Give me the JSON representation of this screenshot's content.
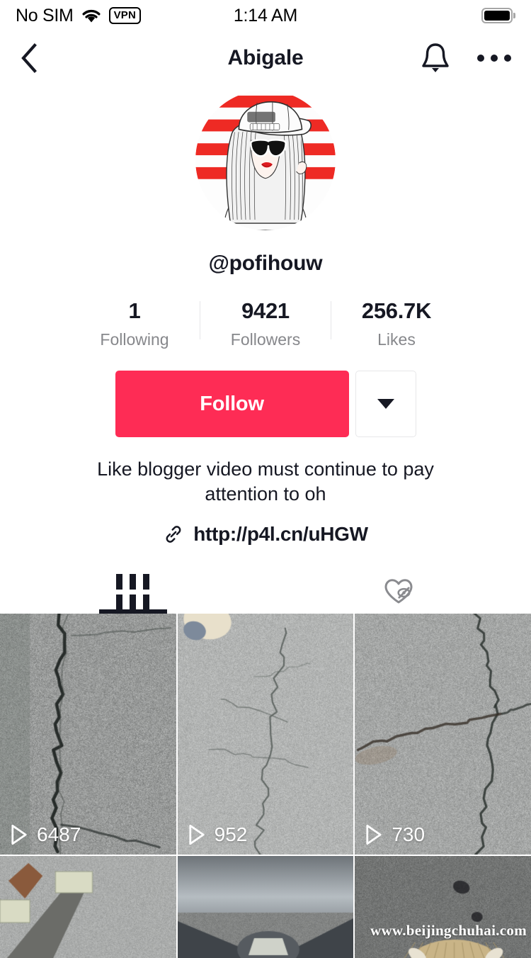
{
  "status_bar": {
    "carrier": "No SIM",
    "vpn": "VPN",
    "time": "1:14 AM",
    "wifi_icon": "wifi-icon",
    "battery_icon": "battery-icon"
  },
  "nav": {
    "title": "Abigale",
    "back_icon": "chevron-left-icon",
    "bell_icon": "bell-icon",
    "more_icon": "more-options-icon"
  },
  "profile": {
    "handle": "@pofihouw",
    "avatar_alt": "avatar-illustration-girl-with-cap-and-sunglasses",
    "bio": "Like blogger video must continue to pay attention to oh",
    "link": "http://p4l.cn/uHGW",
    "link_icon": "link-icon"
  },
  "stats": [
    {
      "value": "1",
      "label": "Following"
    },
    {
      "value": "9421",
      "label": "Followers"
    },
    {
      "value": "256.7K",
      "label": "Likes"
    }
  ],
  "actions": {
    "follow_label": "Follow",
    "dropdown_icon": "chevron-down-icon",
    "follow_color": "#fe2c55"
  },
  "tabs": [
    {
      "id": "videos",
      "icon": "grid-icon",
      "active": true
    },
    {
      "id": "liked",
      "icon": "heart-hidden-icon",
      "active": false
    }
  ],
  "videos": [
    {
      "views": "6487",
      "thumb": "concrete-vertical-crack"
    },
    {
      "views": "952",
      "thumb": "concrete-fine-cracks"
    },
    {
      "views": "730",
      "thumb": "concrete-branching-cracks"
    },
    {
      "views": "",
      "thumb": "rusty-tool-with-money"
    },
    {
      "views": "",
      "thumb": "metal-bolt-joint"
    },
    {
      "views": "",
      "thumb": "asphalt-with-basket"
    }
  ],
  "watermark": "www.beijingchuhai.com",
  "colors": {
    "accent": "#fe2c55",
    "text": "#161823",
    "muted": "#86878b",
    "border": "#e7e7e9"
  }
}
